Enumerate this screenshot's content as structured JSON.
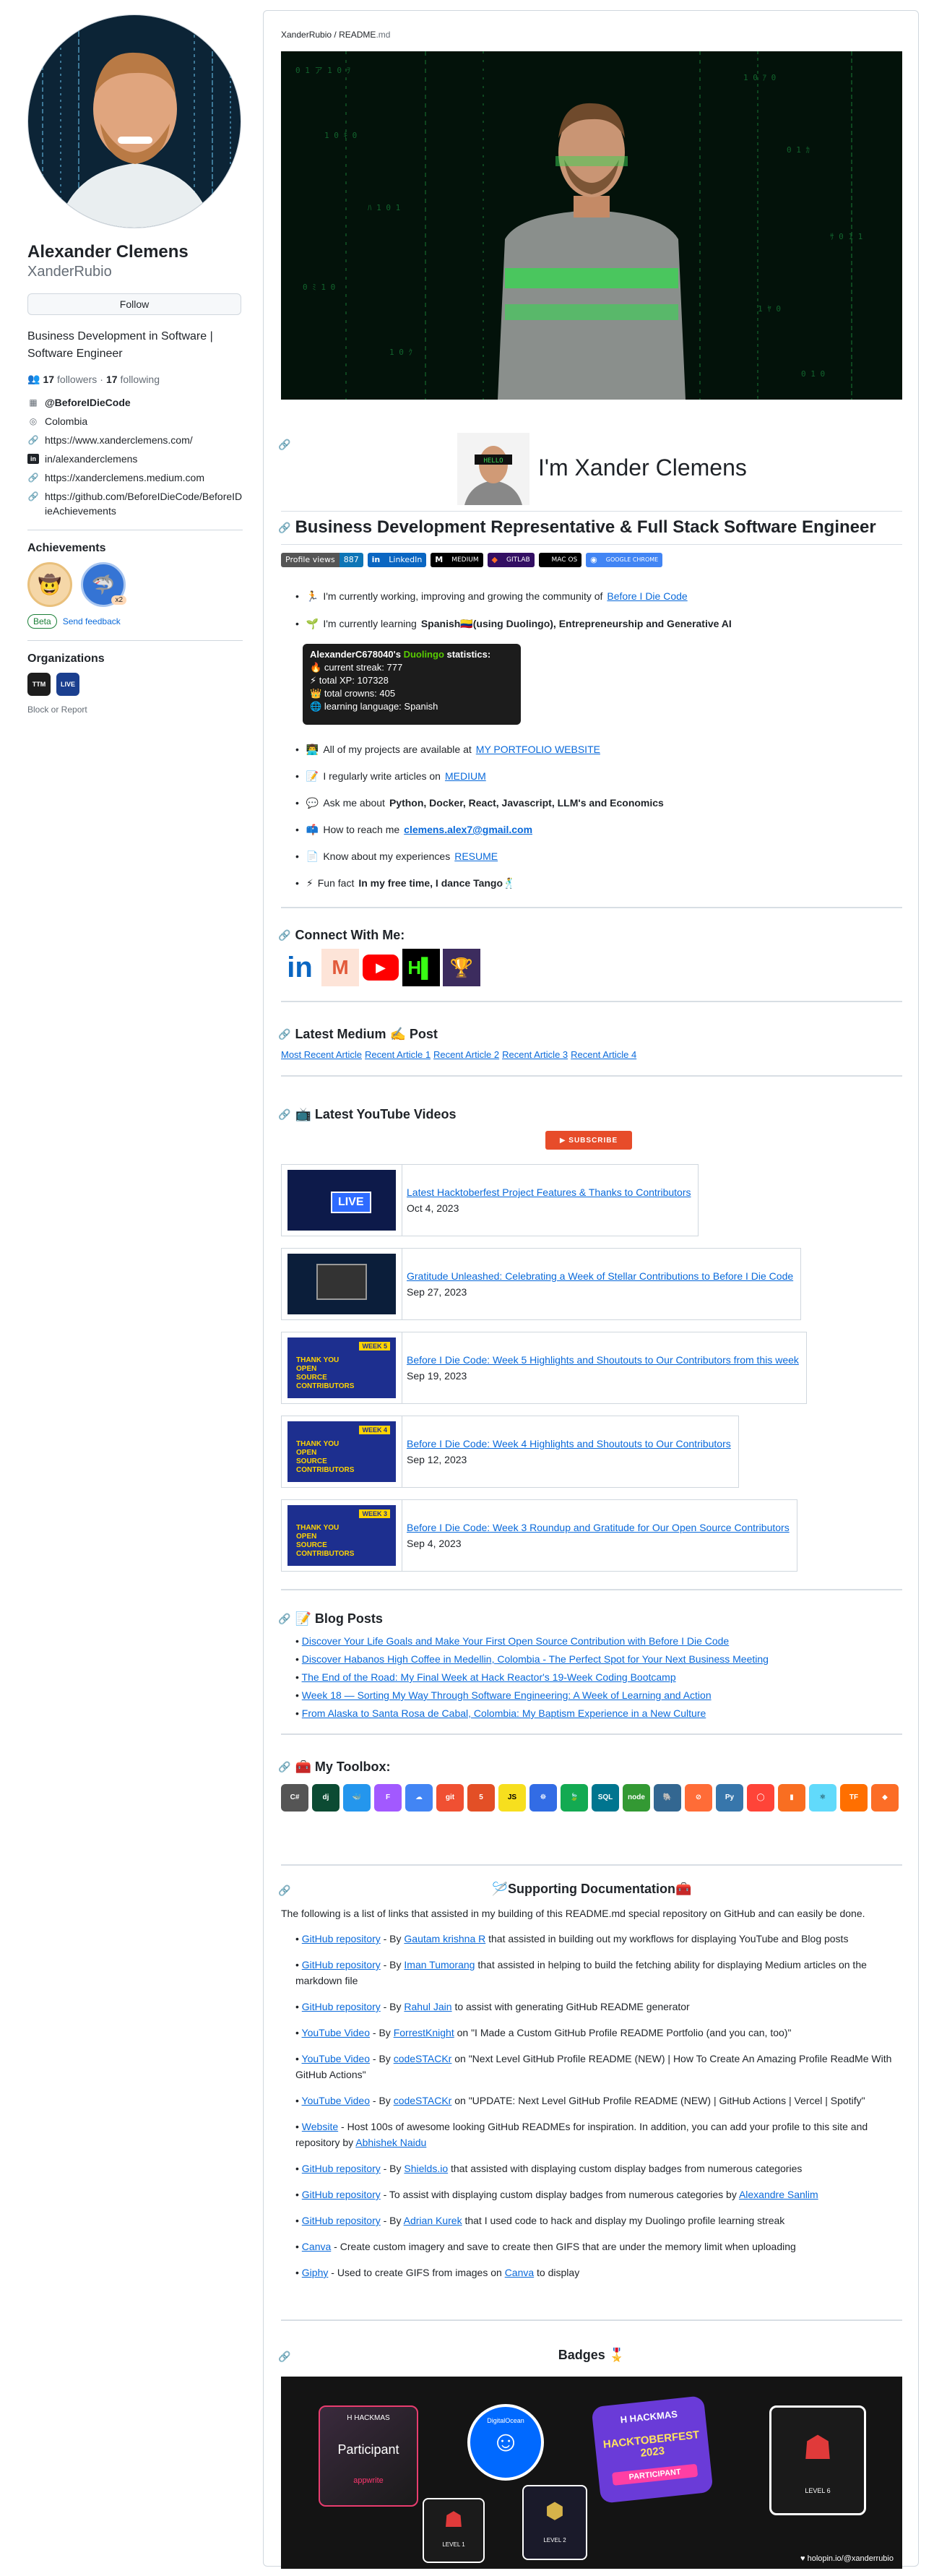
{
  "profile": {
    "fullname": "Alexander Clemens",
    "username": "XanderRubio",
    "follow": "Follow",
    "bio": "Business Development in Software | Software Engineer",
    "followers": "17",
    "followers_label": "followers",
    "following": "17",
    "following_label": "following",
    "sep": "·",
    "vcard": [
      {
        "icon": "at-icon",
        "text": "@BeforeIDieCode",
        "bold": true
      },
      {
        "icon": "location-icon",
        "text": "Colombia"
      },
      {
        "icon": "link-icon",
        "text": "https://www.xanderclemens.com/"
      },
      {
        "icon": "linkedin-icon",
        "text": "in/alexanderclemens"
      },
      {
        "icon": "link-icon",
        "text": "https://xanderclemens.medium.com"
      },
      {
        "icon": "link-icon",
        "text": "https://github.com/BeforeIDieCode/BeforeIDieAchievements"
      }
    ],
    "achievements_title": "Achievements",
    "achv_x2": "x2",
    "beta": "Beta",
    "send_feedback": "Send feedback",
    "orgs_title": "Organizations",
    "org1": "TTM",
    "org2": "LIVE",
    "block": "Block or Report"
  },
  "readme": {
    "crumb_user": "XanderRubio",
    "crumb_sep": "/",
    "crumb_file": "README",
    ".md": ".md",
    "crumb_ext": ".md",
    "hello_sign": "HELLO",
    "intro": "I'm Xander Clemens",
    "headline": "Business Development Representative & Full Stack Software Engineer",
    "shields": [
      {
        "l": "Profile views",
        "r": "887",
        "lc": "#555",
        "rc": "#0e75b6"
      },
      {
        "l": "in",
        "r": "LinkedIn",
        "lc": "#0a66c2",
        "rc": "#0a66c2"
      },
      {
        "l": "M",
        "r": "MEDIUM",
        "lc": "#000",
        "rc": "#000"
      },
      {
        "l": "◆",
        "r": "GITLAB",
        "lc": "#330f63",
        "rc": "#330f63"
      },
      {
        "l": "",
        "r": "MAC OS",
        "lc": "#000",
        "rc": "#000"
      },
      {
        "l": "◉",
        "r": "GOOGLE CHROME",
        "lc": "#4285f4",
        "rc": "#4285f4"
      }
    ],
    "bullets": [
      {
        "emoji": "🏃",
        "pre": "I'm currently working, improving and growing the community of ",
        "link": "Before I Die Code",
        "post": ""
      },
      {
        "emoji": "🌱",
        "pre": "I'm currently learning ",
        "bold": "Spanish🇨🇴(using Duolingo), Entrepreneurship and Generative AI",
        "post": ""
      }
    ],
    "duo": {
      "title_pre": "AlexanderC678040's ",
      "title_duo": "Duolingo",
      "title_post": " statistics:",
      "streak": "current streak: 777",
      "xp": "total XP: 107328",
      "crowns": "total crowns: 405",
      "lang": "learning language: Spanish"
    },
    "bullets2": [
      {
        "emoji": "👨‍💻",
        "pre": "All of my projects are available at ",
        "link": "MY PORTFOLIO WEBSITE"
      },
      {
        "emoji": "📝",
        "pre": "I regularly write articles on ",
        "link": "MEDIUM"
      },
      {
        "emoji": "💬",
        "pre": "Ask me about ",
        "bold": "Python, Docker, React, Javascript, LLM's and Economics"
      },
      {
        "emoji": "📫",
        "pre": "How to reach me ",
        "link": "clemens.alex7@gmail.com"
      },
      {
        "emoji": "📄",
        "pre": "Know about my experiences ",
        "link": "RESUME"
      },
      {
        "emoji": "⚡",
        "pre": "Fun fact ",
        "bold": "In my free time, I dance Tango🕺"
      }
    ],
    "connect": "Connect With Me:",
    "medium_h": "Latest Medium ✍️ Post",
    "medium_links": [
      "Most Recent Article",
      "Recent Article 1",
      "Recent Article 2",
      "Recent Article 3",
      "Recent Article 4"
    ],
    "yt_h": "📺 Latest YouTube Videos",
    "subscribe": "SUBSCRIBE",
    "videos": [
      {
        "t": "Latest Hacktoberfest Project Features & Thanks to Contributors",
        "d": "Oct 4, 2023"
      },
      {
        "t": "Gratitude Unleashed: Celebrating a Week of Stellar Contributions to Before I Die Code",
        "d": "Sep 27, 2023"
      },
      {
        "t": "Before I Die Code: Week 5 Highlights and Shoutouts to Our Contributors from this week",
        "d": "Sep 19, 2023"
      },
      {
        "t": "Before I Die Code: Week 4 Highlights and Shoutouts to Our Contributors",
        "d": "Sep 12, 2023"
      },
      {
        "t": "Before I Die Code: Week 3 Roundup and Gratitude for Our Open Source Contributors",
        "d": "Sep 4, 2023"
      }
    ],
    "blog_h": "📝 Blog Posts",
    "blog": [
      "Discover Your Life Goals and Make Your First Open Source Contribution with Before I Die Code",
      "Discover Habanos High Coffee in Medellin, Colombia - The Perfect Spot for Your Next Business Meeting",
      "The End of the Road: My Final Week at Hack Reactor's 19-Week Coding Bootcamp",
      "Week 18 — Sorting My Way Through Software Engineering: A Week of Learning and Action",
      "From Alaska to Santa Rosa de Cabal, Colombia: My Baptism Experience in a New Culture"
    ],
    "toolbox_h": "🧰 My Toolbox:",
    "doc_h": "🪡Supporting Documentation🧰",
    "doc_intro": "The following is a list of links that assisted in my building of this README.md special repository on GitHub and can easily be done.",
    "docs": [
      {
        "a": "GitHub repository",
        "m": " - By ",
        "b": "Gautam krishna R",
        "e": " that assisted in building out my workflows for displaying YouTube and Blog posts"
      },
      {
        "a": "GitHub repository",
        "m": " - By ",
        "b": "Iman Tumorang",
        "e": " that assisted in helping to build the fetching ability for displaying Medium articles on the markdown file"
      },
      {
        "a": "GitHub repository",
        "m": " - By ",
        "b": "Rahul Jain",
        "e": " to assist with generating GitHub README generator"
      },
      {
        "a": "YouTube Video",
        "m": " - By ",
        "b": "ForrestKnight",
        "e": " on \"I Made a Custom GitHub Profile README Portfolio (and you can, too)\""
      },
      {
        "a": "YouTube Video",
        "m": " - By ",
        "b": "codeSTACKr",
        "e": " on \"Next Level GitHub Profile README (NEW) | How To Create An Amazing Profile ReadMe With GitHub Actions\""
      },
      {
        "a": "YouTube Video",
        "m": " - By ",
        "b": "codeSTACKr",
        "e": " on \"UPDATE: Next Level GitHub Profile README (NEW) | GitHub Actions | Vercel | Spotify\""
      },
      {
        "a": "Website",
        "m": " - Host 100s of awesome looking GitHub READMEs for inspiration. In addition, you can add your profile to this site and repository by ",
        "b": "Abhishek Naidu",
        "e": ""
      },
      {
        "a": "GitHub repository",
        "m": " - By ",
        "b": "Shields.io",
        "e": " that assisted with displaying custom display badges from numerous categories"
      },
      {
        "a": "GitHub repository",
        "m": " - To assist with displaying custom display badges from numerous categories by ",
        "b": "Alexandre Sanlim",
        "e": ""
      },
      {
        "a": "GitHub repository",
        "m": " - By ",
        "b": "Adrian Kurek",
        "e": " that I used code to hack and display my Duolingo profile learning streak"
      },
      {
        "a": "Canva",
        "m": " - Create custom imagery and save to create then GIFS that are under the memory limit when uploading",
        "b": "",
        "e": ""
      },
      {
        "a": "Giphy",
        "m": " - Used to create GIFS from images on ",
        "b": "Canva",
        "e": " to display"
      }
    ],
    "badges_h": "Badges",
    "badges": {
      "participant": "Participant",
      "appwrite": "appwrite",
      "hack": "H HACKMAS",
      "hacktoberfest": "HACKTOBERFEST 2023",
      "participant2": "PARTICIPANT",
      "level6": "LEVEL 6",
      "level1": "LEVEL 1",
      "level2": "LEVEL 2",
      "do": "DigitalOcean",
      "holopin": "holopin.io/@xanderrubio"
    }
  }
}
